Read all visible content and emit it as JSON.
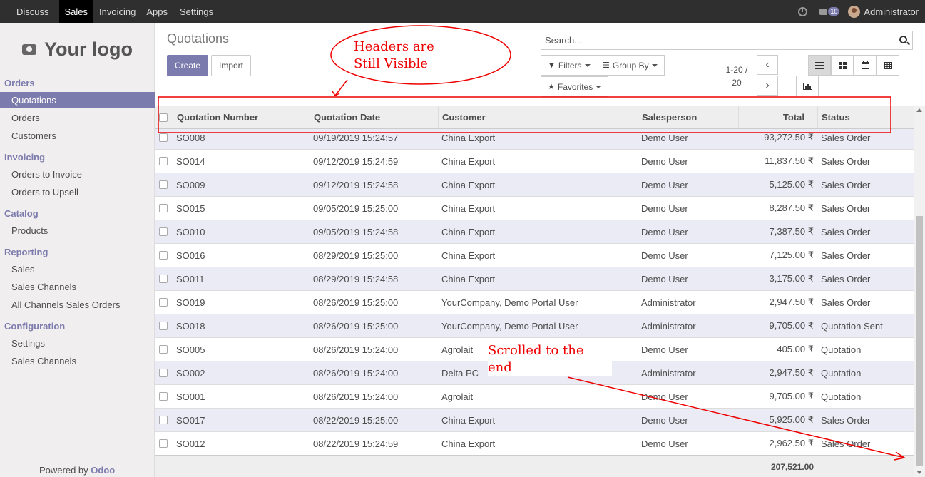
{
  "topbar": {
    "menu": [
      "Discuss",
      "Sales",
      "Invoicing",
      "Apps",
      "Settings"
    ],
    "active": "Sales",
    "messages_badge": "10",
    "user": "Administrator"
  },
  "sidebar": {
    "logo": "Your logo",
    "sections": [
      {
        "label": "Orders",
        "items": [
          "Quotations",
          "Orders",
          "Customers"
        ]
      },
      {
        "label": "Invoicing",
        "items": [
          "Orders to Invoice",
          "Orders to Upsell"
        ]
      },
      {
        "label": "Catalog",
        "items": [
          "Products"
        ]
      },
      {
        "label": "Reporting",
        "items": [
          "Sales",
          "Sales Channels",
          "All Channels Sales Orders"
        ]
      },
      {
        "label": "Configuration",
        "items": [
          "Settings",
          "Sales Channels"
        ]
      }
    ],
    "powered_prefix": "Powered by",
    "powered_brand": "Odoo"
  },
  "control": {
    "title": "Quotations",
    "create": "Create",
    "import": "Import",
    "search_placeholder": "Search...",
    "filters": "Filters",
    "group_by": "Group By",
    "favorites": "Favorites",
    "pager_range": "1-20 /",
    "pager_total": "20"
  },
  "table": {
    "headers": [
      "Quotation Number",
      "Quotation Date",
      "Customer",
      "Salesperson",
      "Total",
      "Status"
    ],
    "rows": [
      [
        "SO008",
        "09/19/2019 15:24:57",
        "China Export",
        "Demo User",
        "93,272.50 ₹",
        "Sales Order"
      ],
      [
        "SO014",
        "09/12/2019 15:24:59",
        "China Export",
        "Demo User",
        "11,837.50 ₹",
        "Sales Order"
      ],
      [
        "SO009",
        "09/12/2019 15:24:58",
        "China Export",
        "Demo User",
        "5,125.00 ₹",
        "Sales Order"
      ],
      [
        "SO015",
        "09/05/2019 15:25:00",
        "China Export",
        "Demo User",
        "8,287.50 ₹",
        "Sales Order"
      ],
      [
        "SO010",
        "09/05/2019 15:24:58",
        "China Export",
        "Demo User",
        "7,387.50 ₹",
        "Sales Order"
      ],
      [
        "SO016",
        "08/29/2019 15:25:00",
        "China Export",
        "Demo User",
        "7,125.00 ₹",
        "Sales Order"
      ],
      [
        "SO011",
        "08/29/2019 15:24:58",
        "China Export",
        "Demo User",
        "3,175.00 ₹",
        "Sales Order"
      ],
      [
        "SO019",
        "08/26/2019 15:25:00",
        "YourCompany, Demo Portal User",
        "Administrator",
        "2,947.50 ₹",
        "Sales Order"
      ],
      [
        "SO018",
        "08/26/2019 15:25:00",
        "YourCompany, Demo Portal User",
        "Administrator",
        "9,705.00 ₹",
        "Quotation Sent"
      ],
      [
        "SO005",
        "08/26/2019 15:24:00",
        "Agrolait",
        "Demo User",
        "405.00 ₹",
        "Quotation"
      ],
      [
        "SO002",
        "08/26/2019 15:24:00",
        "Delta PC",
        "Administrator",
        "2,947.50 ₹",
        "Quotation"
      ],
      [
        "SO001",
        "08/26/2019 15:24:00",
        "Agrolait",
        "Demo User",
        "9,705.00 ₹",
        "Quotation"
      ],
      [
        "SO017",
        "08/22/2019 15:25:00",
        "China Export",
        "Demo User",
        "5,925.00 ₹",
        "Sales Order"
      ],
      [
        "SO012",
        "08/22/2019 15:24:59",
        "China Export",
        "Demo User",
        "2,962.50 ₹",
        "Sales Order"
      ]
    ],
    "footer_total": "207,521.00"
  },
  "annotations": {
    "headers_line1": "Headers  are",
    "headers_line2": "Still  Visible",
    "scrolled": "Scrolled  to  the  end",
    "color": "#e00000"
  }
}
